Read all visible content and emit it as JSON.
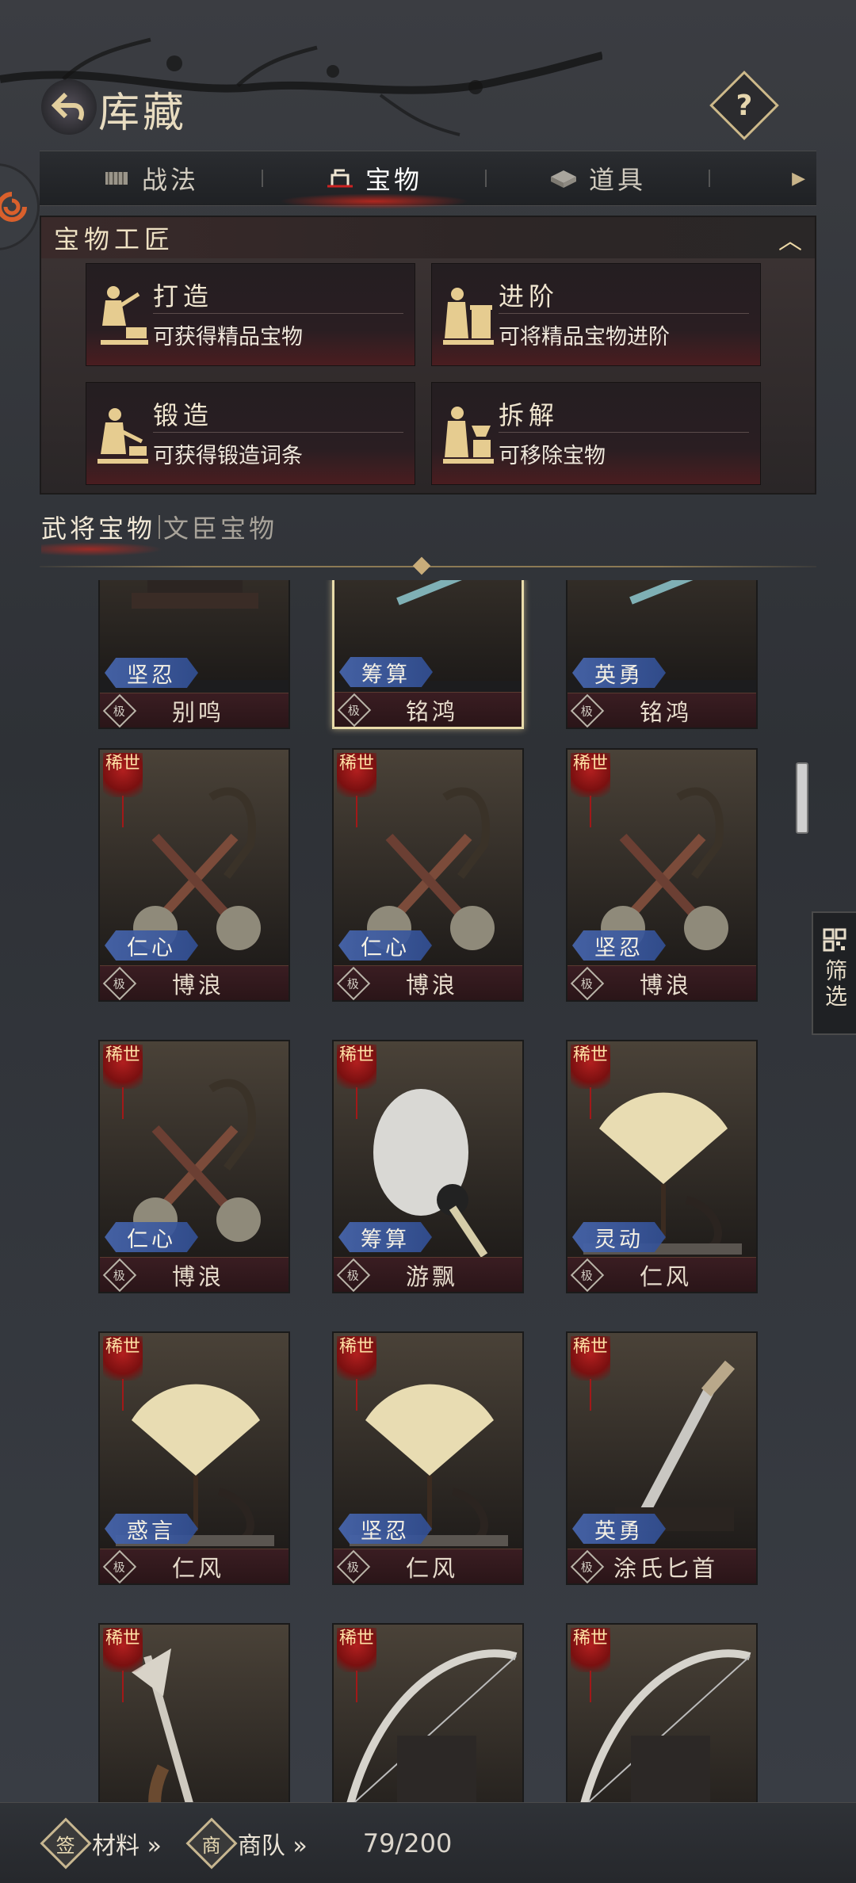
{
  "header": {
    "title": "库藏",
    "help_icon": "question-icon",
    "help_label": "?"
  },
  "tabs": [
    {
      "label": "战法",
      "icon": "scroll-icon",
      "active": false
    },
    {
      "label": "宝物",
      "icon": "treasure-icon",
      "active": true
    },
    {
      "label": "道具",
      "icon": "box-icon",
      "active": false
    }
  ],
  "artisan": {
    "title": "宝物工匠",
    "cards": [
      {
        "name": "打造",
        "desc": "可获得精品宝物",
        "icon": "smith-icon"
      },
      {
        "name": "进阶",
        "desc": "可将精品宝物进阶",
        "icon": "advance-icon"
      },
      {
        "name": "锻造",
        "desc": "可获得锻造词条",
        "icon": "forge-icon"
      },
      {
        "name": "拆解",
        "desc": "可移除宝物",
        "icon": "dismantle-icon"
      }
    ]
  },
  "subtabs": {
    "active": "武将宝物",
    "inactive": "文臣宝物"
  },
  "grade_label": "极",
  "rare_label": "稀世",
  "items": [
    {
      "name": "别鸣",
      "trait": "坚忍",
      "art": "sword-stand",
      "rare": false,
      "selected": false
    },
    {
      "name": "铭鸿",
      "trait": "筹算",
      "art": "long-sword",
      "rare": false,
      "selected": true
    },
    {
      "name": "铭鸿",
      "trait": "英勇",
      "art": "long-sword",
      "rare": false,
      "selected": false
    },
    {
      "name": "博浪",
      "trait": "仁心",
      "art": "mace",
      "rare": true,
      "selected": false
    },
    {
      "name": "博浪",
      "trait": "仁心",
      "art": "mace",
      "rare": true,
      "selected": false
    },
    {
      "name": "博浪",
      "trait": "坚忍",
      "art": "mace",
      "rare": true,
      "selected": false
    },
    {
      "name": "博浪",
      "trait": "仁心",
      "art": "mace",
      "rare": true,
      "selected": false
    },
    {
      "name": "游飘",
      "trait": "筹算",
      "art": "feather-fan",
      "rare": true,
      "selected": false
    },
    {
      "name": "仁风",
      "trait": "灵动",
      "art": "folding-fan",
      "rare": true,
      "selected": false
    },
    {
      "name": "仁风",
      "trait": "惑言",
      "art": "folding-fan",
      "rare": true,
      "selected": false
    },
    {
      "name": "仁风",
      "trait": "坚忍",
      "art": "folding-fan",
      "rare": true,
      "selected": false
    },
    {
      "name": "涂氏匕首",
      "trait": "英勇",
      "art": "dagger",
      "rare": true,
      "selected": false
    },
    {
      "name": "",
      "trait": "",
      "art": "halberd",
      "rare": true,
      "selected": false
    },
    {
      "name": "",
      "trait": "",
      "art": "bow",
      "rare": true,
      "selected": false
    },
    {
      "name": "",
      "trait": "",
      "art": "bow",
      "rare": true,
      "selected": false
    }
  ],
  "filter": {
    "label": "筛选",
    "icon": "grid-icon"
  },
  "bottom": {
    "materials": {
      "label": "材料 »",
      "icon_char": "签"
    },
    "caravan": {
      "label": "商队 »",
      "icon_char": "商"
    },
    "count": "79/200"
  }
}
